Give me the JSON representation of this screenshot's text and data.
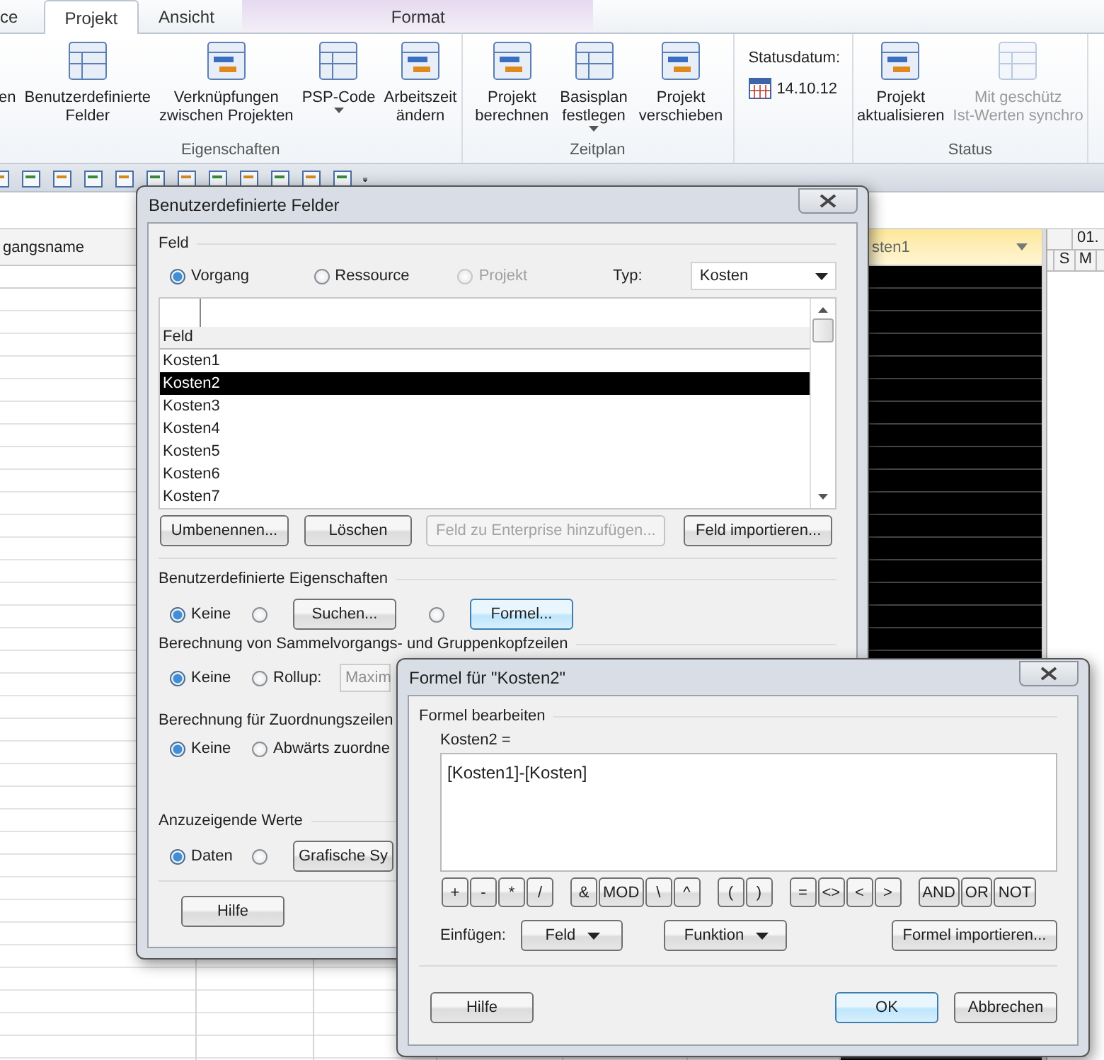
{
  "ribbon": {
    "tabs": [
      {
        "label": "ce",
        "selected": false,
        "kind": "normal"
      },
      {
        "label": "Projekt",
        "selected": true,
        "kind": "normal"
      },
      {
        "label": "Ansicht",
        "selected": false,
        "kind": "normal"
      },
      {
        "label": "Format",
        "selected": false,
        "kind": "contextual"
      }
    ],
    "groups": [
      {
        "label": "Eigenschaften",
        "kind": "buttons",
        "buttons": [
          {
            "label": "en",
            "dropdown": false,
            "disabled": false
          },
          {
            "label": "Benutzerdefinierte\nFelder",
            "dropdown": false,
            "disabled": false
          },
          {
            "label": "Verknüpfungen\nzwischen Projekten",
            "dropdown": false,
            "disabled": false
          },
          {
            "label": "PSP-Code",
            "dropdown": true,
            "disabled": false
          },
          {
            "label": "Arbeitszeit\nändern",
            "dropdown": false,
            "disabled": false
          }
        ]
      },
      {
        "label": "Zeitplan",
        "kind": "buttons",
        "buttons": [
          {
            "label": "Projekt\nberechnen",
            "dropdown": false,
            "disabled": false
          },
          {
            "label": "Basisplan\nfestlegen",
            "dropdown": true,
            "disabled": false
          },
          {
            "label": "Projekt\nverschieben",
            "dropdown": false,
            "disabled": false
          }
        ]
      },
      {
        "kind": "status_date",
        "date_label": "Statusdatum:",
        "date": "14.10.12"
      },
      {
        "label": "Status",
        "kind": "buttons",
        "buttons": [
          {
            "label": "Projekt\naktualisieren",
            "dropdown": false,
            "disabled": false
          },
          {
            "label": "Mit geschütz\nIst-Werten synchro",
            "dropdown": false,
            "disabled": true
          }
        ]
      }
    ]
  },
  "sheet": {
    "columns": [
      {
        "label": "gangsname",
        "kind": "plain"
      },
      {
        "label": "sten1",
        "kind": "selected"
      }
    ],
    "timescale": {
      "week": "01.",
      "days": [
        "S",
        "M"
      ]
    }
  },
  "custom_fields_dialog": {
    "title": "Benutzerdefinierte Felder",
    "field_group": {
      "label": "Feld",
      "options": [
        {
          "label": "Vorgang",
          "selected": true,
          "disabled": false
        },
        {
          "label": "Ressource",
          "selected": false,
          "disabled": false
        },
        {
          "label": "Projekt",
          "selected": false,
          "disabled": true
        }
      ],
      "type_label": "Typ:",
      "type_value": "Kosten",
      "list_header": "Feld",
      "items": [
        {
          "label": "Kosten1",
          "selected": false
        },
        {
          "label": "Kosten2",
          "selected": true
        },
        {
          "label": "Kosten3",
          "selected": false
        },
        {
          "label": "Kosten4",
          "selected": false
        },
        {
          "label": "Kosten5",
          "selected": false
        },
        {
          "label": "Kosten6",
          "selected": false
        },
        {
          "label": "Kosten7",
          "selected": false
        }
      ],
      "buttons": [
        {
          "label": "Umbenennen...",
          "disabled": false
        },
        {
          "label": "Löschen",
          "disabled": false
        },
        {
          "label": "Feld zu Enterprise hinzufügen...",
          "disabled": true
        },
        {
          "label": "Feld importieren...",
          "disabled": false
        }
      ]
    },
    "sections": [
      {
        "label": "Benutzerdefinierte Eigenschaften",
        "options": [
          {
            "kind": "radio",
            "label": "Keine",
            "selected": true
          },
          {
            "kind": "radio_button",
            "button": "Suchen...",
            "selected": false,
            "focused": false
          },
          {
            "kind": "radio_button",
            "button": "Formel...",
            "selected": false,
            "focused": true
          }
        ]
      },
      {
        "label": "Berechnung von Sammelvorgangs- und Gruppenkopfzeilen",
        "options": [
          {
            "kind": "radio",
            "label": "Keine",
            "selected": true
          },
          {
            "kind": "radio_dropdown",
            "label": "Rollup:",
            "value": "Maxim",
            "selected": false
          }
        ]
      },
      {
        "label": "Berechnung für Zuordnungszeilen",
        "options": [
          {
            "kind": "radio",
            "label": "Keine",
            "selected": true
          },
          {
            "kind": "radio",
            "label": "Abwärts zuordne",
            "selected": false
          }
        ]
      },
      {
        "label": "Anzuzeigende Werte",
        "options": [
          {
            "kind": "radio",
            "label": "Daten",
            "selected": true
          },
          {
            "kind": "radio_button",
            "button": "Grafische Sy",
            "selected": false,
            "focused": false
          }
        ]
      }
    ],
    "help_button": "Hilfe"
  },
  "formula_dialog": {
    "title": "Formel für \"Kosten2\"",
    "group_label": "Formel bearbeiten",
    "field_label": "Kosten2 =",
    "formula": "[Kosten1]-[Kosten]",
    "operator_groups": [
      [
        "+",
        "-",
        "*",
        "/"
      ],
      [
        "&",
        "MOD",
        "\\",
        "^"
      ],
      [
        "(",
        ")"
      ],
      [
        "=",
        "<>",
        "<",
        ">"
      ],
      [
        "AND",
        "OR",
        "NOT"
      ]
    ],
    "insert_label": "Einfügen:",
    "insert_menus": [
      "Feld",
      "Funktion"
    ],
    "import_button": "Formel importieren...",
    "buttons": [
      {
        "label": "Hilfe",
        "default": false
      },
      {
        "label": "OK",
        "default": true
      },
      {
        "label": "Abbrechen",
        "default": false
      }
    ]
  }
}
